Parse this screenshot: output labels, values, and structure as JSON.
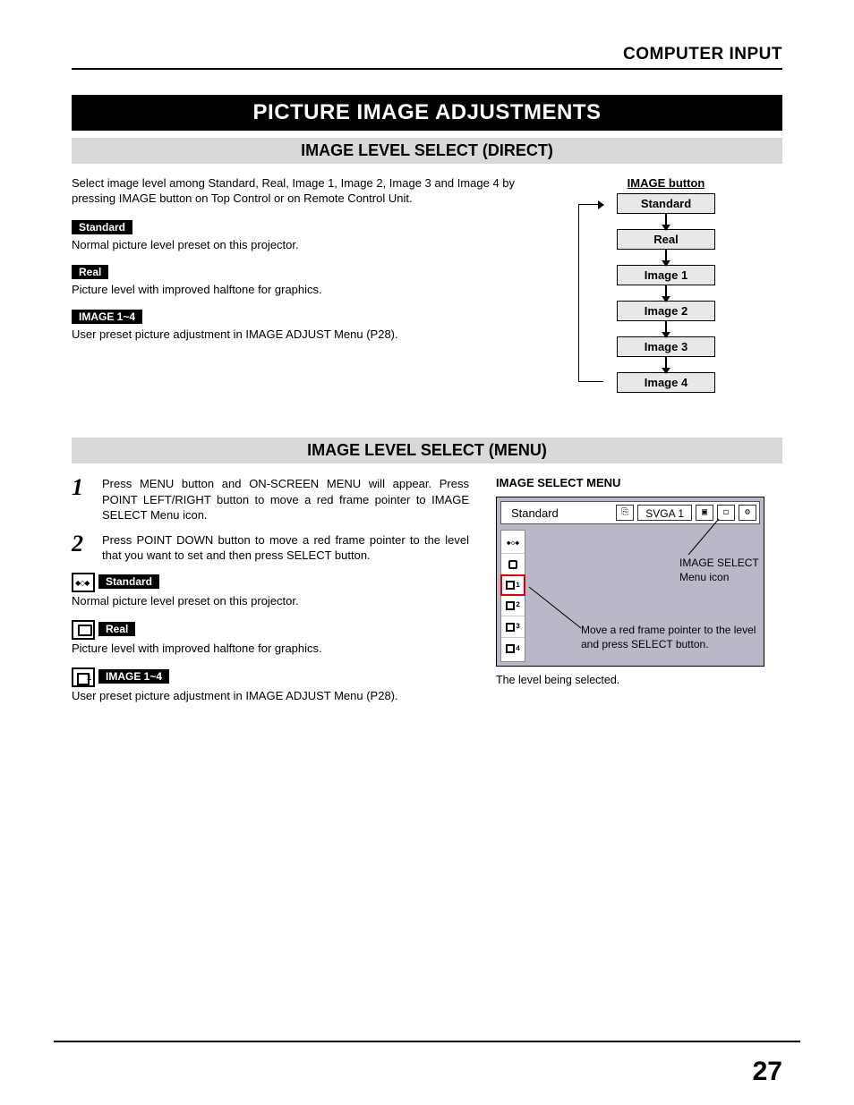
{
  "header": "COMPUTER INPUT",
  "main_title": "PICTURE IMAGE ADJUSTMENTS",
  "section1": {
    "title": "IMAGE LEVEL SELECT (DIRECT)",
    "intro": "Select image level among Standard, Real, Image 1, Image 2, Image 3 and Image 4 by pressing IMAGE button on Top Control or on Remote Control Unit.",
    "items": [
      {
        "tag": "Standard",
        "desc": "Normal picture level preset on this projector."
      },
      {
        "tag": "Real",
        "desc": "Picture level with improved halftone for graphics."
      },
      {
        "tag": "IMAGE 1~4",
        "desc": "User preset picture adjustment in IMAGE ADJUST Menu (P28)."
      }
    ],
    "flow_title": "IMAGE button",
    "flow": [
      "Standard",
      "Real",
      "Image 1",
      "Image 2",
      "Image 3",
      "Image 4"
    ]
  },
  "section2": {
    "title": "IMAGE LEVEL SELECT (MENU)",
    "steps": [
      {
        "num": "1",
        "text": "Press MENU button and ON-SCREEN MENU will appear.  Press POINT LEFT/RIGHT button to move a red frame pointer to IMAGE SELECT Menu icon."
      },
      {
        "num": "2",
        "text": "Press POINT DOWN button to move a red frame pointer to the level that you want to set and then press SELECT button."
      }
    ],
    "items": [
      {
        "icon": "diamonds",
        "tag": "Standard",
        "desc": "Normal picture level preset on this projector."
      },
      {
        "icon": "real",
        "tag": "Real",
        "desc": "Picture level with improved halftone for graphics."
      },
      {
        "icon": "img1",
        "tag": "IMAGE 1~4",
        "desc": "User preset picture adjustment in IMAGE ADJUST Menu (P28)."
      }
    ],
    "menu_title": "IMAGE SELECT MENU",
    "osd_label": "Standard",
    "osd_svga": "SVGA 1",
    "ann1": "IMAGE SELECT Menu icon",
    "ann2": "Move a red frame pointer to the level and press SELECT button.",
    "caption": "The level being selected."
  },
  "page_number": "27"
}
